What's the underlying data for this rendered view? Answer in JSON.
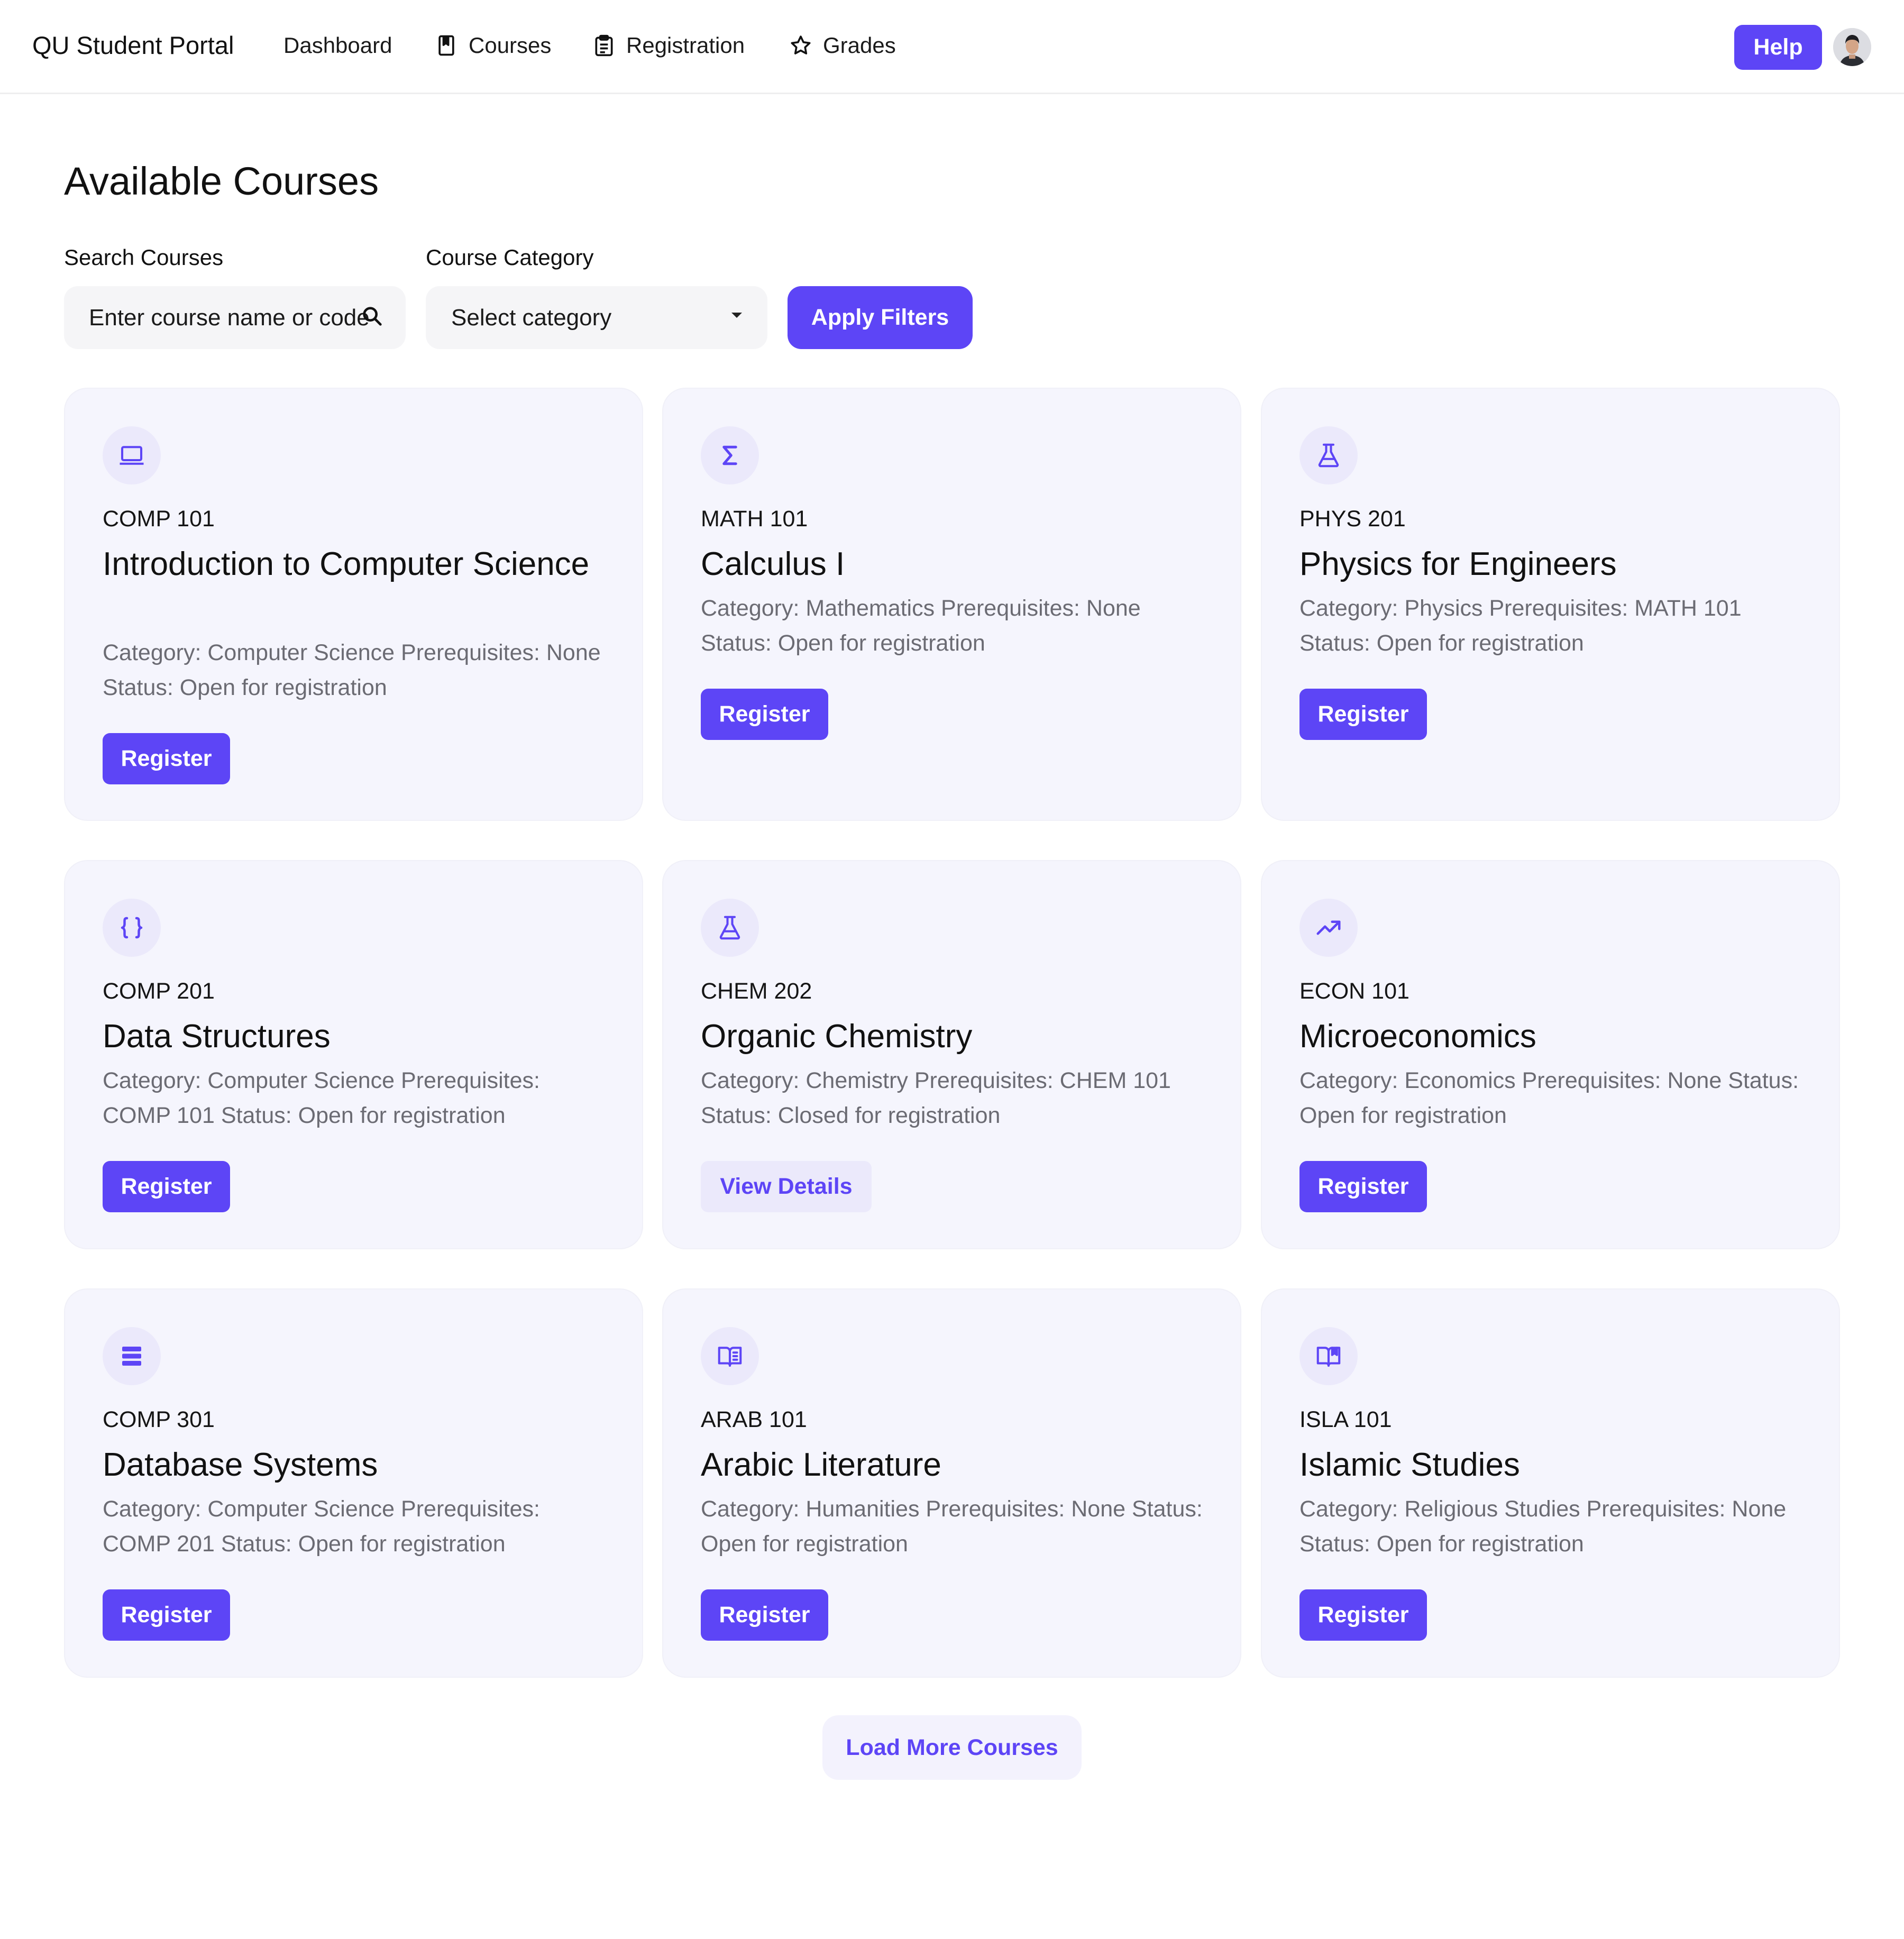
{
  "nav": {
    "brand": "QU Student Portal",
    "links": [
      {
        "label": "Dashboard",
        "icon": ""
      },
      {
        "label": "Courses",
        "icon": "book-icon"
      },
      {
        "label": "Registration",
        "icon": "clipboard-icon"
      },
      {
        "label": "Grades",
        "icon": "star-icon"
      }
    ],
    "help": "Help",
    "avatar_icon": "user-avatar"
  },
  "page": {
    "title": "Available Courses"
  },
  "filters": {
    "search_label": "Search Courses",
    "search_placeholder": "Enter course name or code",
    "category_label": "Course Category",
    "category_value": "Select category",
    "apply": "Apply Filters"
  },
  "accent_color": "#5d45f6",
  "courses": [
    {
      "icon": "laptop-icon",
      "code": "COMP 101",
      "title": "Introduction to Computer Science",
      "desc": "Category: Computer Science Prerequisites: None Status: Open for registration",
      "action": "Register"
    },
    {
      "icon": "sigma-icon",
      "code": "MATH 101",
      "title": "Calculus I",
      "desc": "Category: Mathematics Prerequisites: None Status: Open for registration",
      "action": "Register"
    },
    {
      "icon": "flask-icon",
      "code": "PHYS 201",
      "title": "Physics for Engineers",
      "desc": "Category: Physics Prerequisites: MATH 101 Status: Open for registration",
      "action": "Register"
    },
    {
      "icon": "braces-icon",
      "code": "COMP 201",
      "title": "Data Structures",
      "desc": "Category: Computer Science Prerequisites: COMP 101 Status: Open for registration",
      "action": "Register"
    },
    {
      "icon": "flask-icon",
      "code": "CHEM 202",
      "title": "Organic Chemistry",
      "desc": "Category: Chemistry Prerequisites: CHEM 101 Status: Closed for registration",
      "action": "View Details"
    },
    {
      "icon": "trending-up-icon",
      "code": "ECON 101",
      "title": "Microeconomics",
      "desc": "Category: Economics Prerequisites: None Status: Open for registration",
      "action": "Register"
    },
    {
      "icon": "database-icon",
      "code": "COMP 301",
      "title": "Database Systems",
      "desc": "Category: Computer Science Prerequisites: COMP 201 Status: Open for registration",
      "action": "Register"
    },
    {
      "icon": "open-book-icon",
      "code": "ARAB 101",
      "title": "Arabic Literature",
      "desc": "Category: Humanities Prerequisites: None Status: Open for registration",
      "action": "Register"
    },
    {
      "icon": "book-bookmark-icon",
      "code": "ISLA 101",
      "title": "Islamic Studies",
      "desc": "Category: Religious Studies Prerequisites: None Status: Open for registration",
      "action": "Register"
    }
  ],
  "load_more": "Load More Courses"
}
